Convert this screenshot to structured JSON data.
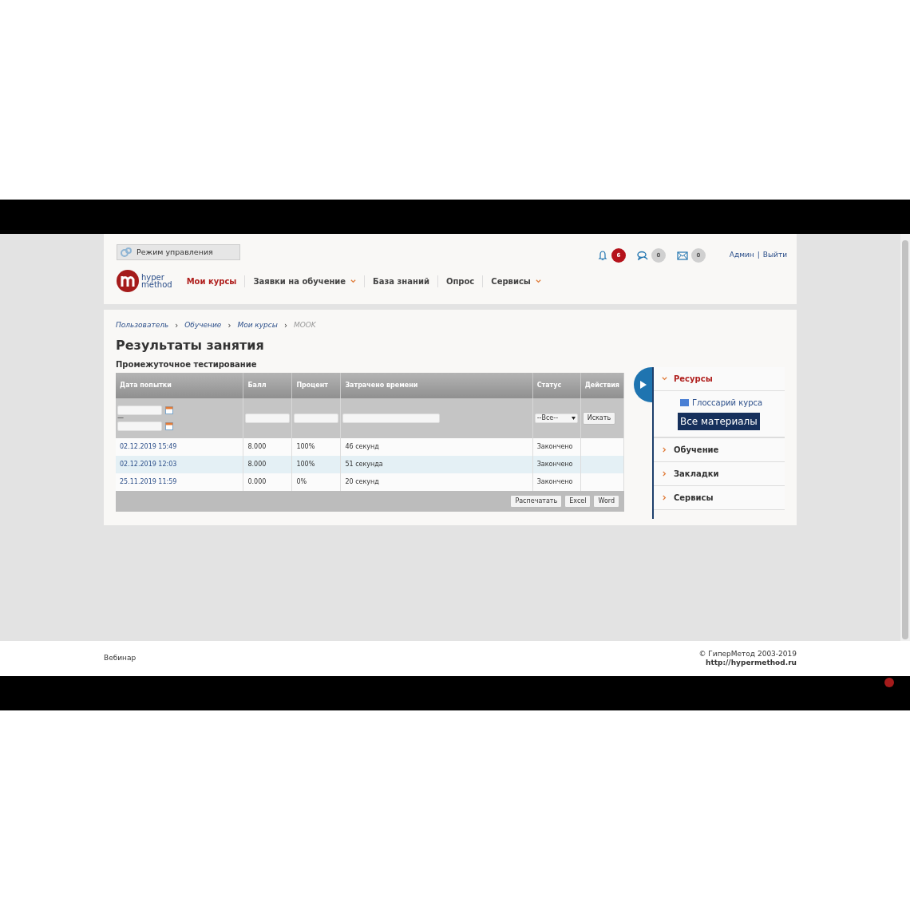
{
  "admin_mode_button": {
    "label": "Режим управления"
  },
  "logo": {
    "line_1": "hyper",
    "line_2": "method"
  },
  "nav": [
    {
      "label": "Мои курсы",
      "selected": true,
      "dropdown": false
    },
    {
      "label": "Заявки на обучение",
      "selected": false,
      "dropdown": true
    },
    {
      "label": "База знаний",
      "selected": false,
      "dropdown": false
    },
    {
      "label": "Опрос",
      "selected": false,
      "dropdown": false
    },
    {
      "label": "Сервисы",
      "selected": false,
      "dropdown": true
    }
  ],
  "notifications": [
    {
      "kind": "bell",
      "count": "6",
      "active": true
    },
    {
      "kind": "chat",
      "count": "0",
      "active": false
    },
    {
      "kind": "mail",
      "count": "0",
      "active": false
    }
  ],
  "user": {
    "name": "Админ",
    "separator": "|",
    "logout": "Выйти"
  },
  "breadcrumbs": [
    {
      "label": "Пользователь",
      "current": false
    },
    {
      "label": "Обучение",
      "current": false
    },
    {
      "label": "Мои курсы",
      "current": false
    },
    {
      "label": "MOOK",
      "current": true
    }
  ],
  "breadcrumb_separator": "›",
  "title": "Результаты занятия",
  "subtitle": "Промежуточное тестирование",
  "table": {
    "columns": [
      "Дата попытки",
      "Балл",
      "Процент",
      "Затрачено времени",
      "Статус",
      "Действия"
    ],
    "filter": {
      "date_separator": "—",
      "status_select": "--Все--",
      "search_button": "Искать"
    },
    "rows": [
      {
        "selected": false,
        "cells": [
          "02.12.2019 15:49",
          "8.000",
          "100%",
          "46 секунд",
          "Закончено"
        ]
      },
      {
        "selected": true,
        "cells": [
          "02.12.2019 12:03",
          "8.000",
          "100%",
          "51 секунда",
          "Закончено"
        ]
      },
      {
        "selected": false,
        "cells": [
          "25.11.2019 11:59",
          "0.000",
          "0%",
          "20 секунд",
          "Закончено"
        ]
      }
    ],
    "export_buttons": [
      "Распечатать",
      "Excel",
      "Word"
    ]
  },
  "sidebar": {
    "items": [
      {
        "label": "Ресурсы",
        "expanded": true,
        "children": [
          {
            "label": "Глоссарий курса",
            "selected": false
          },
          {
            "label": "Все материалы",
            "selected": true
          }
        ]
      },
      {
        "label": "Обучение",
        "expanded": false
      },
      {
        "label": "Закладки",
        "expanded": false
      },
      {
        "label": "Сервисы",
        "expanded": false
      }
    ]
  },
  "footer": {
    "left": "Вебинар",
    "copyright": "© ГиперМетод 2003-2019",
    "url": "http://hypermethod.ru"
  }
}
